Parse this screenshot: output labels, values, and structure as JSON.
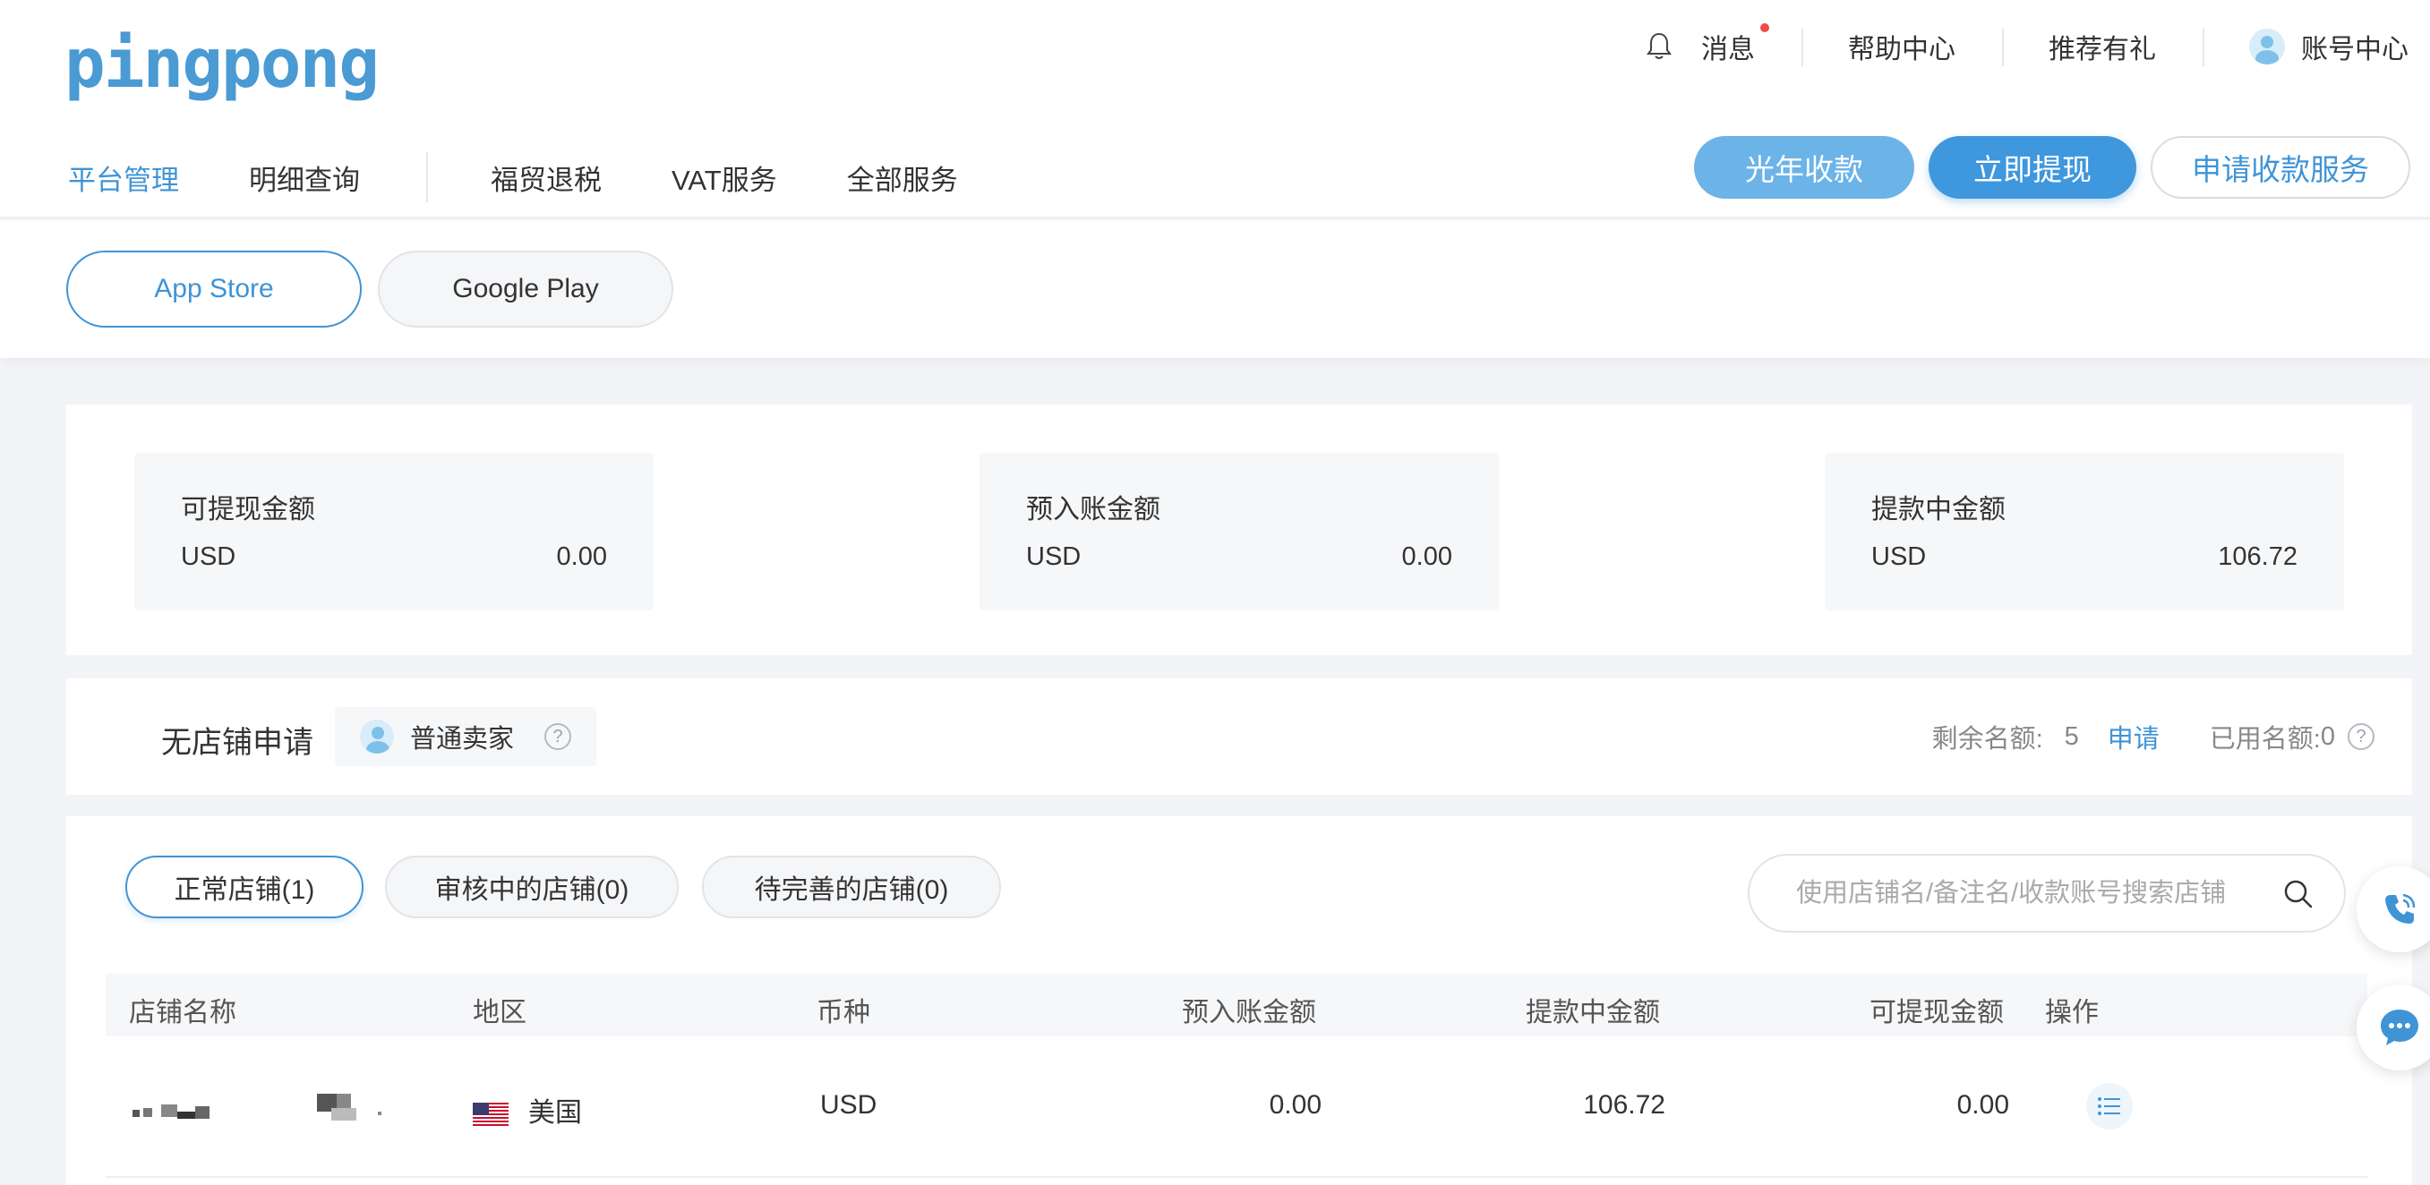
{
  "brand": {
    "logo_text": "pingpong",
    "accent": "#3f94d6"
  },
  "topbar": {
    "messages": "消息",
    "help": "帮助中心",
    "referral": "推荐有礼",
    "account": "账号中心"
  },
  "nav": {
    "items": [
      "平台管理",
      "明细查询",
      "福贸退税",
      "VAT服务",
      "全部服务"
    ],
    "active": "平台管理"
  },
  "actions": {
    "guangnian": "光年收款",
    "withdraw": "立即提现",
    "apply_service": "申请收款服务"
  },
  "store_tabs": [
    "App Store",
    "Google Play"
  ],
  "balances": [
    {
      "label": "可提现金额",
      "currency": "USD",
      "amount": "0.00"
    },
    {
      "label": "预入账金额",
      "currency": "USD",
      "amount": "0.00"
    },
    {
      "label": "提款中金额",
      "currency": "USD",
      "amount": "106.72"
    }
  ],
  "quota": {
    "title": "无店铺申请",
    "seller_type": "普通卖家",
    "remaining_label": "剩余名额:",
    "remaining_value": "5",
    "apply": "申请",
    "used_label": "已用名额:",
    "used_value": "0",
    "help_glyph": "?"
  },
  "status_tabs": [
    "正常店铺(1)",
    "审核中的店铺(0)",
    "待完善的店铺(0)"
  ],
  "search": {
    "placeholder": "使用店铺名/备注名/收款账号搜索店铺"
  },
  "table": {
    "headers": [
      "店铺名称",
      "地区",
      "币种",
      "预入账金额",
      "提款中金额",
      "可提现金额",
      "操作"
    ],
    "rows": [
      {
        "region": "美国",
        "currency": "USD",
        "pending": "0.00",
        "withdrawing": "106.72",
        "available": "0.00"
      }
    ]
  }
}
